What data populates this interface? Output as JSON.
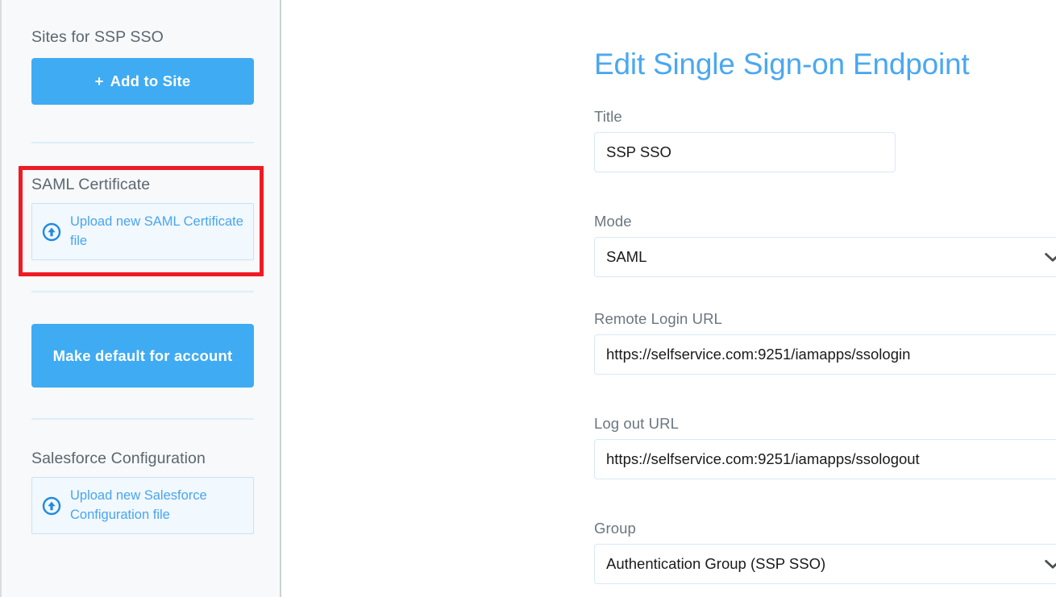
{
  "sidebar": {
    "sites_heading": "Sites for SSP SSO",
    "add_to_site_button": "Add to Site",
    "add_to_site_plus": "+",
    "saml_heading": "SAML Certificate",
    "saml_upload_label": "Upload new SAML Certificate file",
    "saml_upload_icon": "upload-circle-icon",
    "make_default_button": "Make default for account",
    "salesforce_heading": "Salesforce Configuration",
    "salesforce_upload_label": "Upload new Salesforce Configuration file",
    "salesforce_upload_icon": "upload-circle-icon",
    "highlight_color": "#ef1b24",
    "accent_color": "#3fabf3"
  },
  "main": {
    "page_title": "Edit Single Sign-on Endpoint",
    "title_label": "Title",
    "title_value": "SSP SSO",
    "mode_label": "Mode",
    "mode_value": "SAML",
    "remote_login_label": "Remote Login URL",
    "remote_login_value": "https://selfservice.com:9251/iamapps/ssologin",
    "logout_label": "Log out URL",
    "logout_value": "https://selfservice.com:9251/iamapps/ssologout",
    "group_label": "Group",
    "group_value": "Authentication Group (SSP SSO)",
    "chevron_icon": "chevron-down-icon",
    "title_color": "#4aa8f0"
  }
}
